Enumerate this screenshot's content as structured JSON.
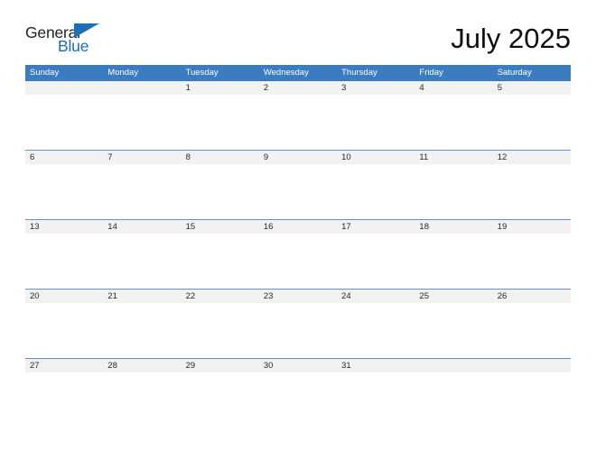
{
  "brand": {
    "name_top": "General",
    "name_bottom": "Blue",
    "color_dark": "#231f20",
    "color_blue": "#1b6cb3",
    "triangle_color": "#1f6fb8"
  },
  "header": {
    "title": "July 2025",
    "month": "July",
    "year": "2025"
  },
  "colors": {
    "header_band": "#3a7cbe",
    "header_text": "#ffffff",
    "date_band": "#f2f2f2",
    "date_text": "#272727",
    "week_rule": "#5b92cf",
    "page_background": "#ffffff"
  },
  "weekday_headers": [
    "Sunday",
    "Monday",
    "Tuesday",
    "Wednesday",
    "Thursday",
    "Friday",
    "Saturday"
  ],
  "weeks": [
    {
      "index": 0,
      "days": [
        "",
        "",
        "1",
        "2",
        "3",
        "4",
        "5"
      ]
    },
    {
      "index": 1,
      "days": [
        "6",
        "7",
        "8",
        "9",
        "10",
        "11",
        "12"
      ]
    },
    {
      "index": 2,
      "days": [
        "13",
        "14",
        "15",
        "16",
        "17",
        "18",
        "19"
      ]
    },
    {
      "index": 3,
      "days": [
        "20",
        "21",
        "22",
        "23",
        "24",
        "25",
        "26"
      ]
    },
    {
      "index": 4,
      "days": [
        "27",
        "28",
        "29",
        "30",
        "31",
        "",
        ""
      ]
    }
  ]
}
